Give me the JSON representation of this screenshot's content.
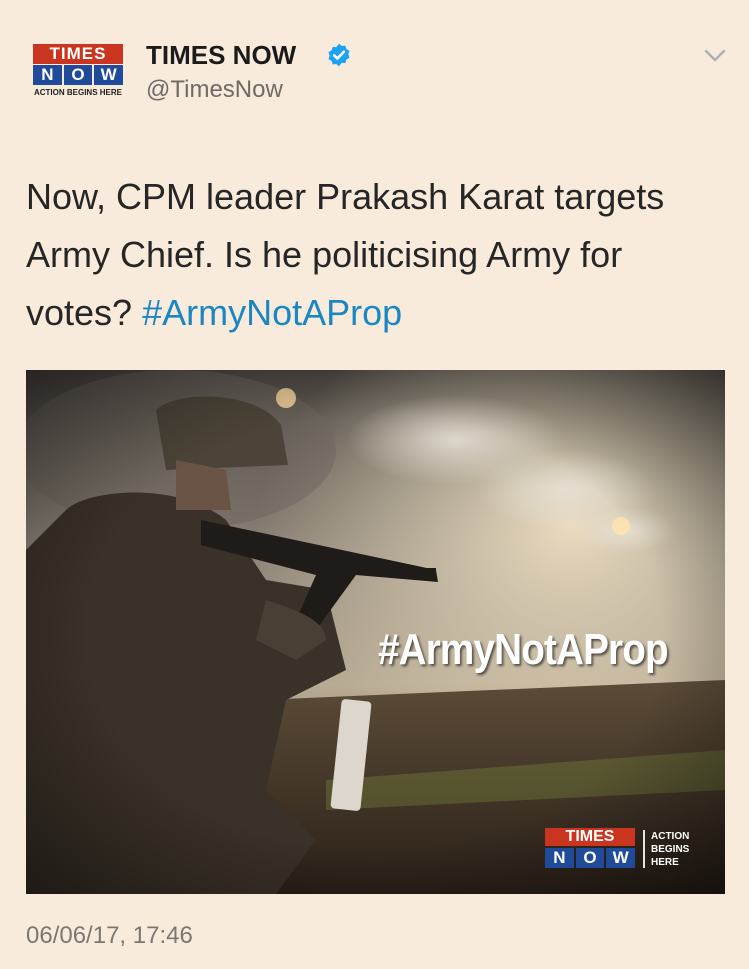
{
  "account": {
    "logo": {
      "line1": "TIMES",
      "line2": [
        "N",
        "O",
        "W"
      ],
      "tagline": "ACTION BEGINS HERE"
    },
    "name": "TIMES NOW",
    "verified_icon": "verified-badge-icon",
    "handle": "@TimesNow",
    "menu_icon": "chevron-down-icon"
  },
  "tweet": {
    "text": "Now, CPM leader Prakash Karat targets Army Chief. Is he politicising Army for votes?",
    "hashtag": "#ArmyNotAProp"
  },
  "media": {
    "overlay_hashtag": "#ArmyNotAProp",
    "watermark": {
      "line1": "TIMES",
      "line2": [
        "N",
        "O",
        "W"
      ],
      "tagline": [
        "ACTION",
        "BEGINS",
        "HERE"
      ]
    }
  },
  "timestamp": "06/06/17, 17:46",
  "colors": {
    "background": "#f9ebdc",
    "hashtag": "#1a86c2",
    "verified": "#1da1f2",
    "logo_red": "#c9351f",
    "logo_blue": "#1f4b9a"
  }
}
